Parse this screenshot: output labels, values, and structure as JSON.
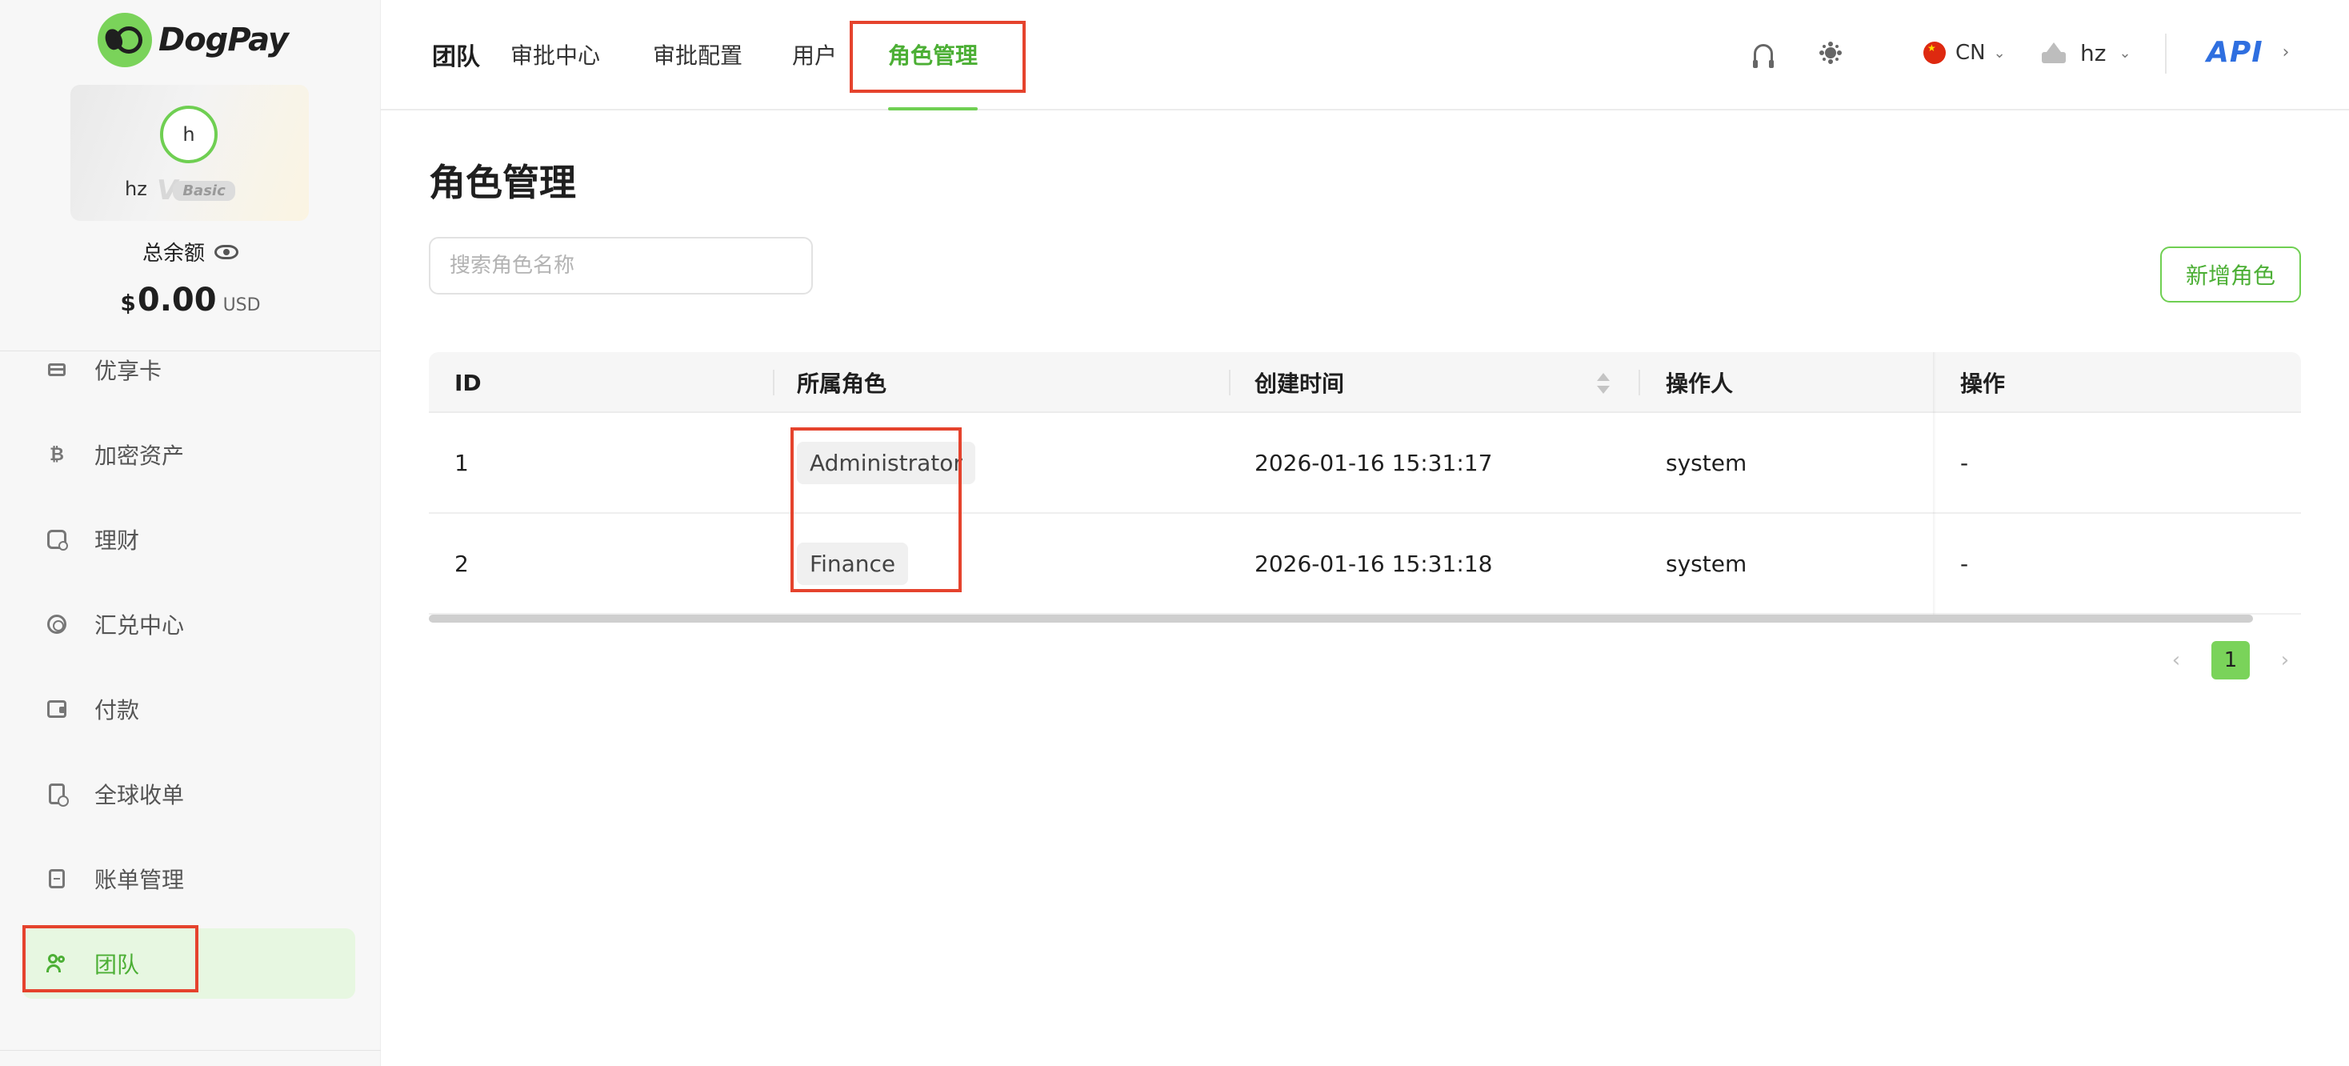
{
  "brand": {
    "name": "DogPay"
  },
  "profile": {
    "avatar_letter": "h",
    "name": "hz",
    "vip_letter": "V",
    "vip_level": "Basic"
  },
  "balance": {
    "label": "总余额",
    "symbol": "$",
    "amount": "0.00",
    "currency": "USD"
  },
  "sidebar": {
    "items": [
      {
        "label": "优享卡",
        "icon": "card-icon"
      },
      {
        "label": "加密资产",
        "icon": "bitcoin-icon"
      },
      {
        "label": "理财",
        "icon": "finance-icon"
      },
      {
        "label": "汇兑中心",
        "icon": "exchange-icon"
      },
      {
        "label": "付款",
        "icon": "wallet-icon"
      },
      {
        "label": "全球收单",
        "icon": "clipboard-icon"
      },
      {
        "label": "账单管理",
        "icon": "bill-icon"
      },
      {
        "label": "团队",
        "icon": "team-icon",
        "active": true
      }
    ]
  },
  "topbar": {
    "tabs": [
      {
        "label": "团队"
      },
      {
        "label": "审批中心"
      },
      {
        "label": "审批配置"
      },
      {
        "label": "用户"
      },
      {
        "label": "角色管理",
        "active": true
      }
    ],
    "language": "CN",
    "user": "hz",
    "api_label": "API"
  },
  "page": {
    "title": "角色管理",
    "search_placeholder": "搜索角色名称",
    "add_button": "新增角色"
  },
  "table": {
    "columns": [
      "ID",
      "所属角色",
      "创建时间",
      "操作人",
      "操作"
    ],
    "rows": [
      {
        "id": "1",
        "role": "Administrator",
        "created": "2026-01-16 15:31:17",
        "operator": "system",
        "action": "-"
      },
      {
        "id": "2",
        "role": "Finance",
        "created": "2026-01-16 15:31:18",
        "operator": "system",
        "action": "-"
      }
    ]
  },
  "pagination": {
    "current": "1",
    "prev": "‹",
    "next": "›"
  },
  "colors": {
    "accent": "#4caf35",
    "accent_light": "#7ad35a",
    "highlight_box": "#e5432d",
    "api": "#2f6fe0"
  }
}
